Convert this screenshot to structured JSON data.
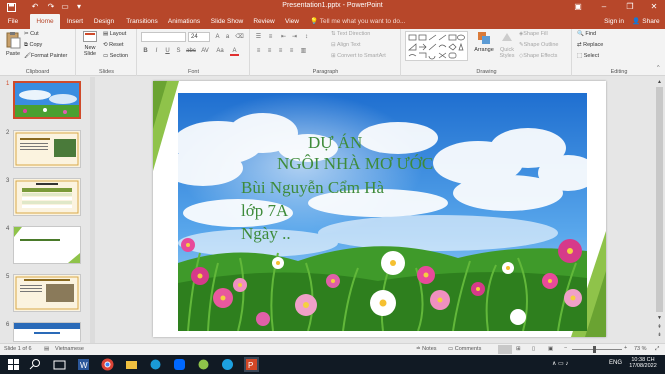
{
  "window": {
    "title": "Presentation1.pptx - PowerPoint",
    "min": "–",
    "max": "❐",
    "close": "✕"
  },
  "tabs": [
    "File",
    "Home",
    "Insert",
    "Design",
    "Transitions",
    "Animations",
    "Slide Show",
    "Review",
    "View"
  ],
  "tell_me": "Tell me what you want to do...",
  "account": {
    "signin": "Sign in",
    "share": "Share"
  },
  "ribbon": {
    "clipboard": {
      "paste": "Paste",
      "cut": "Cut",
      "copy": "Copy",
      "format_painter": "Format Painter",
      "label": "Clipboard"
    },
    "slides": {
      "new_slide": "New",
      "new_slide2": "Slide",
      "layout": "Layout",
      "reset": "Reset",
      "section": "Section",
      "label": "Slides"
    },
    "font": {
      "size": "24",
      "label": "Font",
      "b": "B",
      "i": "I",
      "u": "U",
      "s": "S",
      "abc": "abc",
      "av": "AV",
      "aa": "Aa",
      "a": "A"
    },
    "paragraph": {
      "text_direction": "Text Direction",
      "align_text": "Align Text",
      "convert": "Convert to SmartArt",
      "label": "Paragraph"
    },
    "drawing": {
      "arrange": "Arrange",
      "quick_styles": "Quick",
      "quick_styles2": "Styles",
      "shape_fill": "Shape Fill",
      "shape_outline": "Shape Outline",
      "shape_effects": "Shape Effects",
      "label": "Drawing"
    },
    "editing": {
      "find": "Find",
      "replace": "Replace",
      "select": "Select",
      "label": "Editing"
    }
  },
  "thumbnails": [
    {
      "num": "1"
    },
    {
      "num": "2"
    },
    {
      "num": "3"
    },
    {
      "num": "4"
    },
    {
      "num": "5"
    },
    {
      "num": "6"
    }
  ],
  "slide": {
    "line1": "DỰ ÁN",
    "line2": "NGÔI NHÀ MƠ ƯỚC",
    "line3": "Bùi Nguyễn Cẩm Hà",
    "line4": "lớp 7A",
    "line5": "Ngày .."
  },
  "status": {
    "slide_of": "Slide 1 of 6",
    "language": "Vietnamese",
    "notes": "Notes",
    "comments": "Comments",
    "zoom": "73 %"
  },
  "taskbar": {
    "lang": "ENG",
    "time": "10:38 CH",
    "date": "17/08/2022"
  },
  "colors": {
    "accent": "#b7472a",
    "slide_text": "#3e8b3a",
    "sky_top": "#2a7fd6"
  }
}
